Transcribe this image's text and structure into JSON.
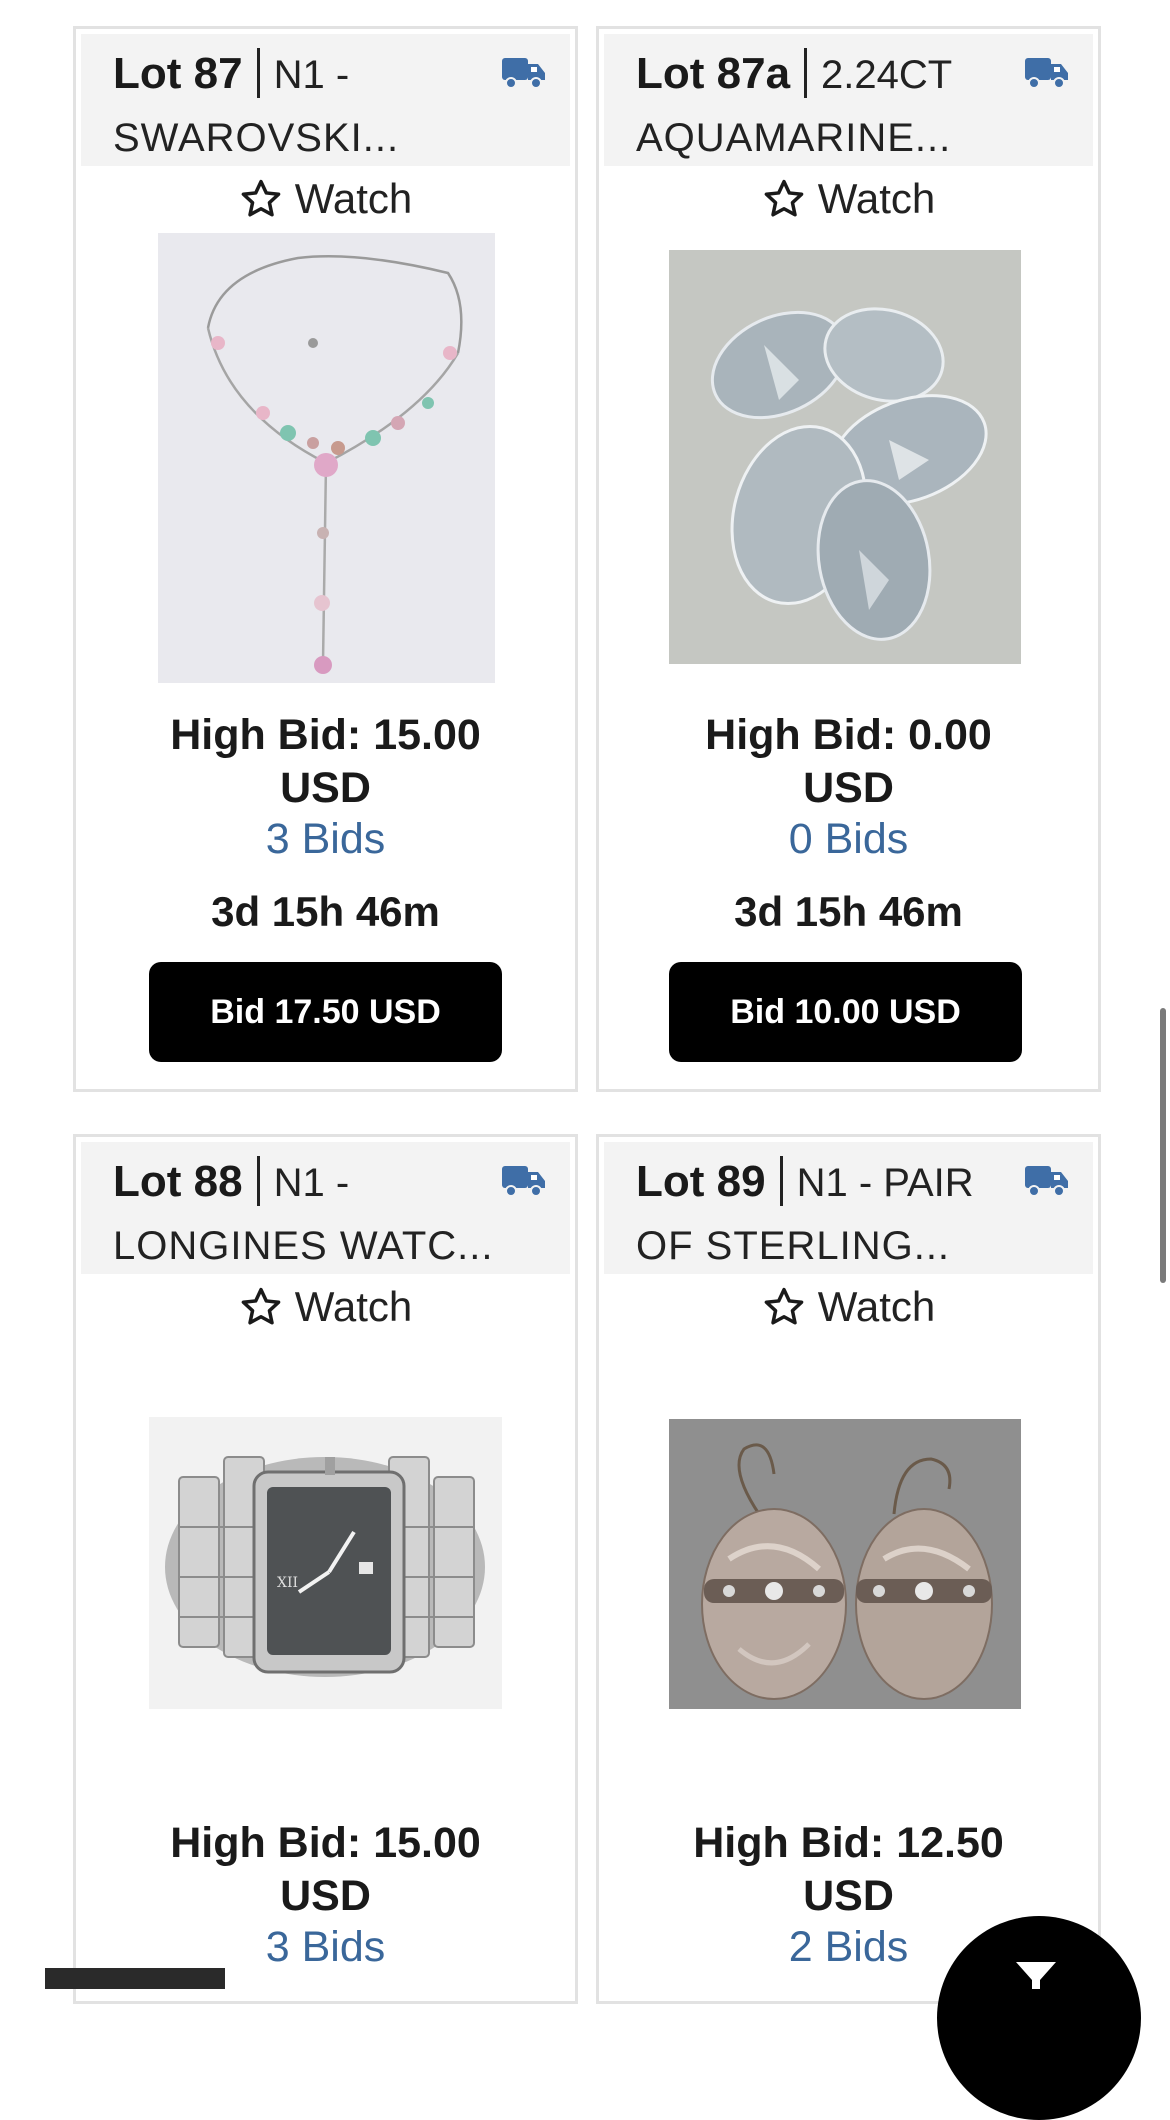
{
  "colors": {
    "accent_link": "#3a679a",
    "truck_icon": "#3f6ea7",
    "button_bg": "#000000",
    "header_bg": "#f3f3f3"
  },
  "lots": [
    {
      "lot_label": "Lot 87",
      "title_line1": "N1 -",
      "title_line2": "SWAROVSKI...",
      "shipping_icon": "truck-icon",
      "watch_label": "Watch",
      "high_bid": "High Bid: 15.00",
      "currency": "USD",
      "bids": "3 Bids",
      "time_left": "3d 15h 46m",
      "bid_button": "Bid 17.50 USD",
      "image": "necklace"
    },
    {
      "lot_label": "Lot 87a",
      "title_line1": "2.24CT",
      "title_line2": "AQUAMARINE...",
      "shipping_icon": "truck-icon",
      "watch_label": "Watch",
      "high_bid": "High Bid: 0.00",
      "currency": "USD",
      "bids": "0 Bids",
      "time_left": "3d 15h 46m",
      "bid_button": "Bid 10.00 USD",
      "image": "aquamarine-stones"
    },
    {
      "lot_label": "Lot 88",
      "title_line1": "N1 -",
      "title_line2": "LONGINES WATC...",
      "shipping_icon": "truck-icon",
      "watch_label": "Watch",
      "high_bid": "High Bid: 15.00",
      "currency": "USD",
      "bids": "3 Bids",
      "image": "wristwatch"
    },
    {
      "lot_label": "Lot 89",
      "title_line1": "N1 - PAIR",
      "title_line2": "OF STERLING...",
      "shipping_icon": "truck-icon",
      "watch_label": "Watch",
      "high_bid": "High Bid: 12.50",
      "currency": "USD",
      "bids": "2 Bids",
      "image": "earrings"
    }
  ]
}
